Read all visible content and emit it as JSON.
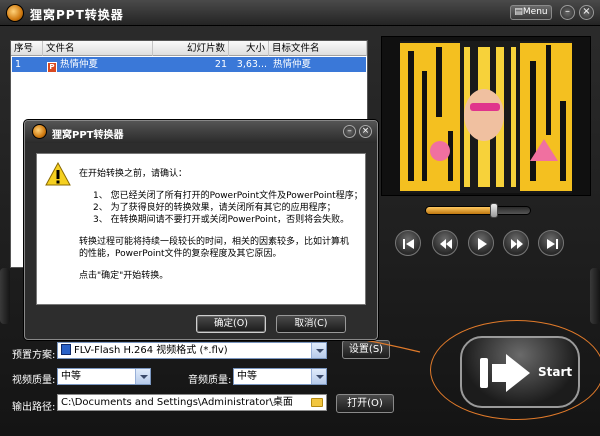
{
  "window": {
    "title": "狸窝PPT转换器",
    "menu_label": "Menu",
    "min_label": "–",
    "close_label": "×"
  },
  "table": {
    "headers": [
      "序号",
      "文件名",
      "幻灯片数",
      "大小",
      "目标文件名"
    ],
    "rows": [
      {
        "index": "1",
        "filename": "热情仲夏",
        "slides": "21",
        "size": "3,63...",
        "target": "热情仲夏"
      }
    ]
  },
  "preview": {
    "progress": 0.65,
    "controls": [
      "previous-icon",
      "rewind-icon",
      "play-icon",
      "forward-icon",
      "next-icon"
    ]
  },
  "settings": {
    "preset_label": "预置方案:",
    "preset_value": "FLV-Flash H.264 视频格式 (*.flv)",
    "settings_button": "设置(S)",
    "video_quality_label": "视频质量:",
    "video_quality_value": "中等",
    "audio_quality_label": "音频质量:",
    "audio_quality_value": "中等",
    "output_label": "输出路径:",
    "output_value": "C:\\Documents and Settings\\Administrator\\桌面",
    "open_button": "打开(O)"
  },
  "start_button": {
    "label": "Start"
  },
  "dialog": {
    "title": "狸窝PPT转换器",
    "intro": "在开始转换之前，请确认：",
    "items": [
      "1、 您已经关闭了所有打开的PowerPoint文件及PowerPoint程序；",
      "2、 为了获得良好的转换效果，请关闭所有其它的应用程序；",
      "3、 在转换期间请不要打开或关闭PowerPoint，否则将会失败。"
    ],
    "note_line1": "转换过程可能将持续一段较长的时间，相关的因素较多，比如计算机",
    "note_line2": "的性能，PowerPoint文件的复杂程度及其它原因。",
    "prompt": "点击\"确定\"开始转换。",
    "ok_button": "确定(O)",
    "cancel_button": "取消(C)",
    "min_label": "–",
    "close_label": "×"
  },
  "colors": {
    "accent": "#e07a2a",
    "selection": "#3a78d8",
    "panel": "#2d2d2d"
  }
}
